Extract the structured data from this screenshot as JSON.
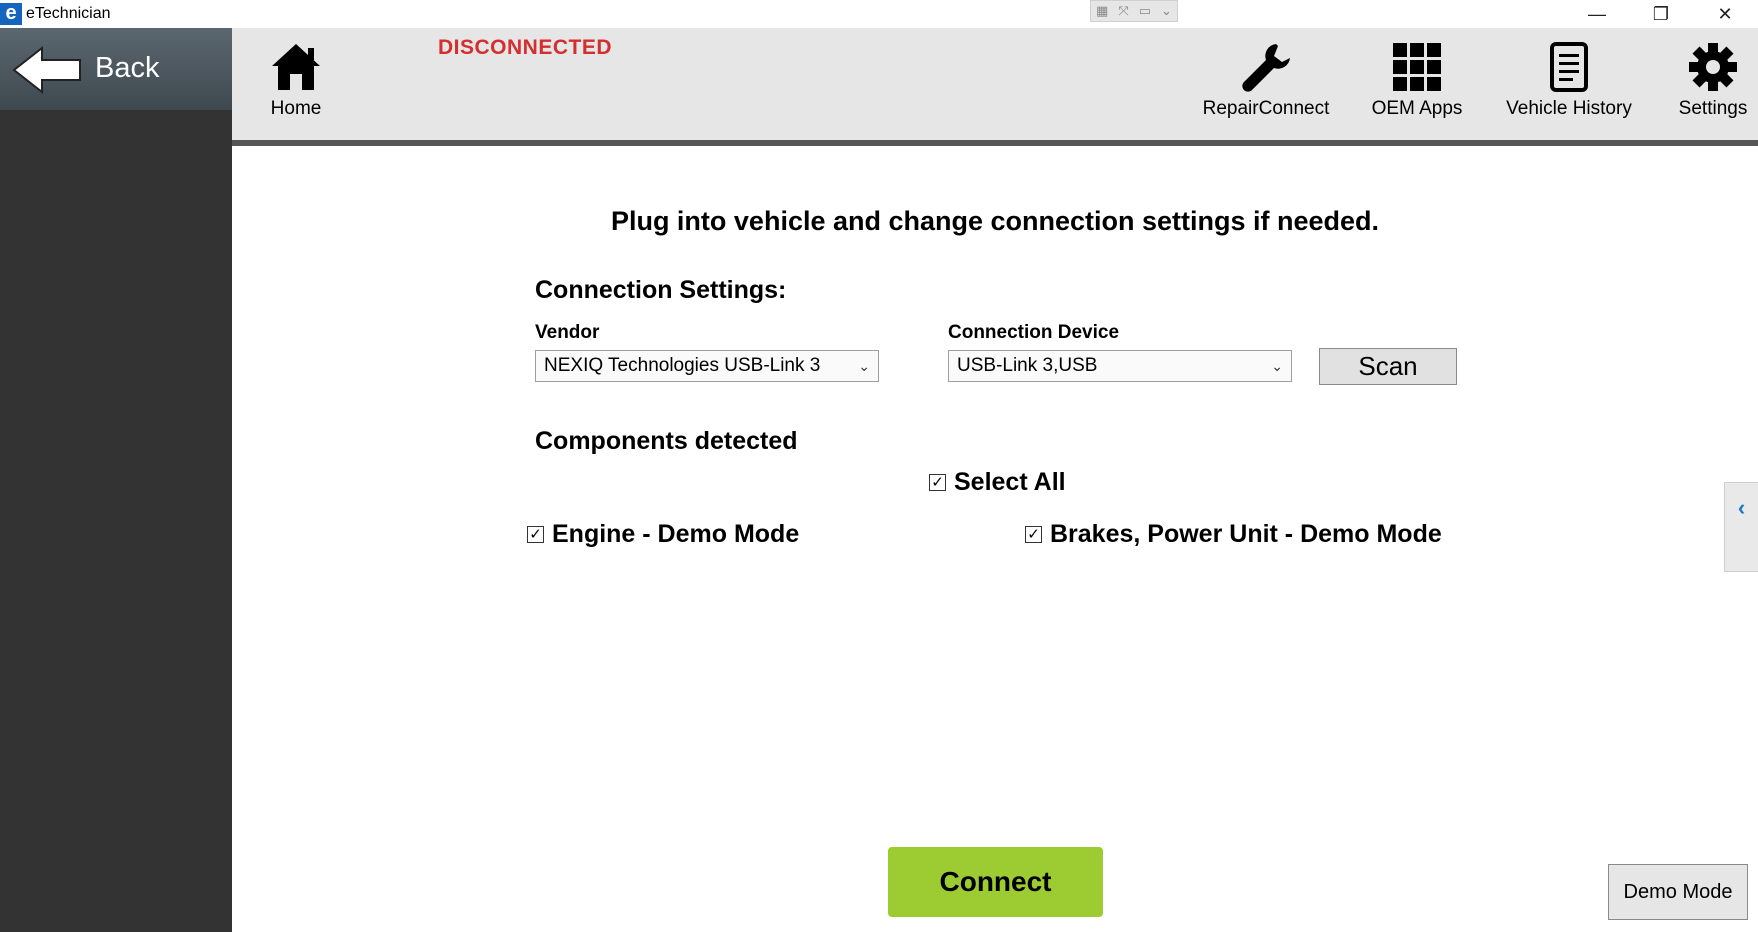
{
  "window": {
    "title": "eTechnician",
    "logo_letter": "e",
    "minimize": "—",
    "restore": "❐",
    "close": "✕"
  },
  "sidebar": {
    "back_label": "Back"
  },
  "toolbar": {
    "home": "Home",
    "status": "DISCONNECTED",
    "repairconnect": "RepairConnect",
    "oem_apps": "OEM Apps",
    "vehicle_history": "Vehicle History",
    "settings": "Settings",
    "status_color": "#d32f2f"
  },
  "main": {
    "instruction": "Plug into vehicle and change connection settings if needed.",
    "connection_settings_title": "Connection Settings:",
    "vendor_label": "Vendor",
    "vendor_value": "NEXIQ Technologies USB-Link 3",
    "device_label": "Connection Device",
    "device_value": "USB-Link 3,USB",
    "scan_label": "Scan",
    "components_title": "Components detected",
    "select_all_label": "Select All",
    "select_all_checked": true,
    "components": [
      {
        "label": "Engine - Demo Mode",
        "checked": true
      },
      {
        "label": "Brakes, Power Unit - Demo Mode",
        "checked": true
      }
    ],
    "connect_label": "Connect",
    "demo_mode_label": "Demo Mode",
    "side_tab_glyph": "‹",
    "check_glyph": "✓",
    "chevron_glyph": "⌄",
    "connect_color": "#9ccc32"
  }
}
